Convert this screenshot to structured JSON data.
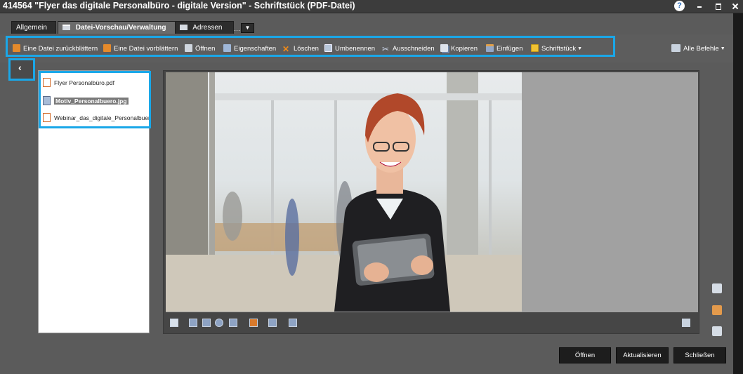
{
  "window": {
    "title": "414564 \"Flyer das digitale Personalbüro - digitale Version\" - Schriftstück (PDF-Datei)",
    "help_label": "?"
  },
  "tabs": [
    {
      "label": "Allgemein"
    },
    {
      "label": "Datei-Vorschau/Verwaltung",
      "icon": "folder-icon",
      "active": true
    },
    {
      "label": "Adressen",
      "icon": "address-card-icon"
    },
    {
      "label": "…"
    }
  ],
  "tab_more_label": "▼",
  "toolbar": {
    "items": [
      {
        "label": "Eine Datei zurückblättern",
        "icon": "file-back-icon"
      },
      {
        "label": "Eine Datei vorblättern",
        "icon": "file-forward-icon"
      },
      {
        "label": "Öffnen",
        "icon": "open-icon"
      },
      {
        "label": "Eigenschaften",
        "icon": "properties-icon"
      },
      {
        "label": "Löschen",
        "icon": "delete-icon"
      },
      {
        "label": "Umbenennen",
        "icon": "rename-icon"
      },
      {
        "label": "Ausschneiden",
        "icon": "cut-icon"
      },
      {
        "label": "Kopieren",
        "icon": "copy-icon"
      },
      {
        "label": "Einfügen",
        "icon": "paste-icon"
      },
      {
        "label": "Schriftstück",
        "icon": "document-icon",
        "dropdown": true
      }
    ],
    "all_commands_label": "Alle Befehle"
  },
  "collapse_label": "‹",
  "files": [
    {
      "name": "Flyer Personalbüro.pdf",
      "type": "pdf"
    },
    {
      "name": "Motiv_Personalbuero.jpg",
      "type": "image",
      "selected": true
    },
    {
      "name": "Webinar_das_digitale_Personalbuer",
      "type": "pdf"
    }
  ],
  "buttons": {
    "open": "Öffnen",
    "refresh": "Aktualisieren",
    "close": "Schließen"
  },
  "colors": {
    "highlight": "#1aa7e8",
    "background": "#5b5b5b",
    "button_bg": "#1d1d1d"
  }
}
